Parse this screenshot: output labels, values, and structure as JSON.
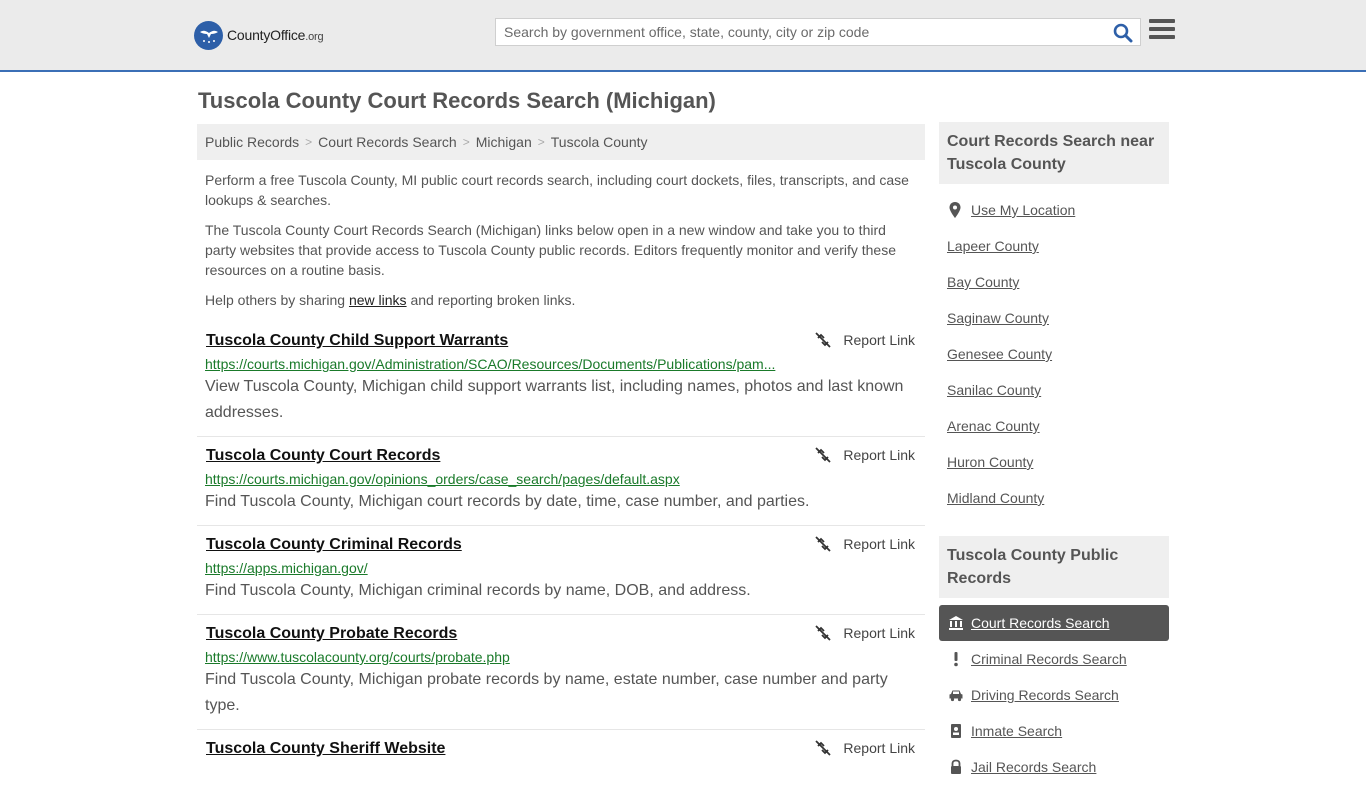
{
  "header": {
    "logo_name": "CountyOffice",
    "logo_suffix": ".org",
    "search_placeholder": "Search by government office, state, county, city or zip code"
  },
  "page_title": "Tuscola County Court Records Search (Michigan)",
  "breadcrumb": [
    "Public Records",
    "Court Records Search",
    "Michigan",
    "Tuscola County"
  ],
  "intro": {
    "p1": "Perform a free Tuscola County, MI public court records search, including court dockets, files, transcripts, and case lookups & searches.",
    "p2": "The Tuscola County Court Records Search (Michigan) links below open in a new window and take you to third party websites that provide access to Tuscola County public records. Editors frequently monitor and verify these resources on a routine basis.",
    "p3_before": "Help others by sharing ",
    "p3_link": "new links",
    "p3_after": " and reporting broken links."
  },
  "report_label": "Report Link",
  "results": [
    {
      "title": "Tuscola County Child Support Warrants",
      "url": "https://courts.michigan.gov/Administration/SCAO/Resources/Documents/Publications/pam...",
      "desc": "View Tuscola County, Michigan child support warrants list, including names, photos and last known addresses."
    },
    {
      "title": "Tuscola County Court Records",
      "url": "https://courts.michigan.gov/opinions_orders/case_search/pages/default.aspx",
      "desc": "Find Tuscola County, Michigan court records by date, time, case number, and parties."
    },
    {
      "title": "Tuscola County Criminal Records",
      "url": "https://apps.michigan.gov/",
      "desc": "Find Tuscola County, Michigan criminal records by name, DOB, and address."
    },
    {
      "title": "Tuscola County Probate Records",
      "url": "https://www.tuscolacounty.org/courts/probate.php",
      "desc": "Find Tuscola County, Michigan probate records by name, estate number, case number and party type."
    },
    {
      "title": "Tuscola County Sheriff Website",
      "url": "",
      "desc": ""
    }
  ],
  "sidebar": {
    "nearby_title": "Court Records Search near Tuscola County",
    "use_location": "Use My Location",
    "nearby": [
      "Lapeer County",
      "Bay County",
      "Saginaw County",
      "Genesee County",
      "Sanilac County",
      "Arenac County",
      "Huron County",
      "Midland County"
    ],
    "public_records_title": "Tuscola County Public Records",
    "public_records": [
      {
        "label": "Court Records Search",
        "icon": "courthouse-icon",
        "active": true
      },
      {
        "label": "Criminal Records Search",
        "icon": "exclamation-icon",
        "active": false
      },
      {
        "label": "Driving Records Search",
        "icon": "car-icon",
        "active": false
      },
      {
        "label": "Inmate Search",
        "icon": "id-badge-icon",
        "active": false
      },
      {
        "label": "Jail Records Search",
        "icon": "lock-icon",
        "active": false
      }
    ]
  },
  "colors": {
    "header_bg": "#ebebeb",
    "header_border": "#3b6fb6",
    "url_green": "#1a7a2a",
    "active_item_bg": "#555555",
    "search_icon": "#2d5fa8"
  }
}
